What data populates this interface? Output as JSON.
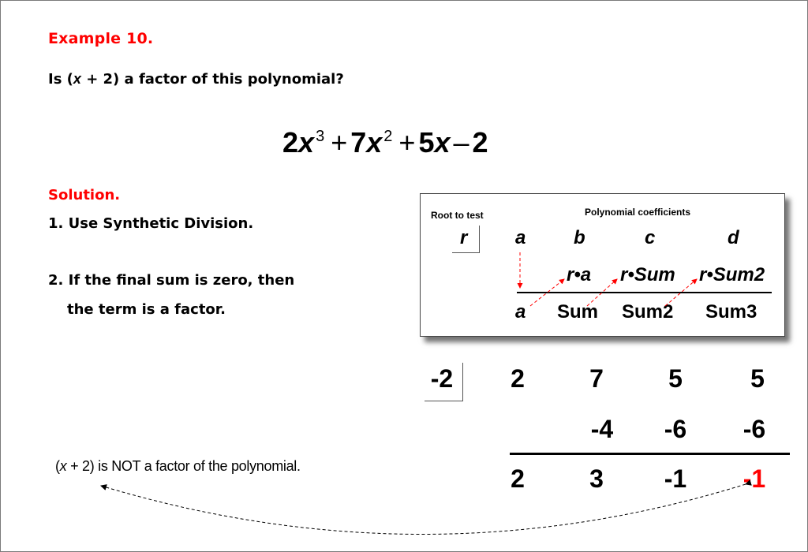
{
  "header": {
    "title": "Example 10.",
    "question_prefix": "Is (",
    "question_var": "x",
    "question_suffix": " + 2) a factor of this polynomial?"
  },
  "polynomial": {
    "terms": [
      {
        "coef": "2",
        "var": "x",
        "exp": "3"
      },
      {
        "op": "+",
        "coef": "7",
        "var": "x",
        "exp": "2"
      },
      {
        "op": "+",
        "coef": "5",
        "var": "x",
        "exp": ""
      },
      {
        "op": "–",
        "coef": "2",
        "var": "",
        "exp": ""
      }
    ]
  },
  "solution": {
    "label": "Solution.",
    "step1": "1. Use Synthetic Division.",
    "step2_line1": "2. If the final sum is zero, then",
    "step2_line2": "the term is a factor."
  },
  "template_box": {
    "root_label": "Root to test",
    "coef_label": "Polynomial coefficients",
    "root_symbol": "r",
    "coefficients": [
      "a",
      "b",
      "c",
      "d"
    ],
    "products": [
      "r•a",
      "r•Sum",
      "r•Sum2"
    ],
    "sums": [
      "a",
      "Sum",
      "Sum2",
      "Sum3"
    ],
    "arrow_color": "#ff0000"
  },
  "division": {
    "root": "-2",
    "coefficients": [
      "2",
      "7",
      "5",
      "5"
    ],
    "products": [
      "-4",
      "-6",
      "-6"
    ],
    "sums": [
      "2",
      "3",
      "-1",
      "-1"
    ],
    "remainder_color": "#ff0000"
  },
  "conclusion": {
    "prefix": "(",
    "var": "x",
    "suffix": " + 2) is NOT a factor of the polynomial."
  },
  "colors": {
    "accent": "#ff0000",
    "text": "#000000"
  }
}
